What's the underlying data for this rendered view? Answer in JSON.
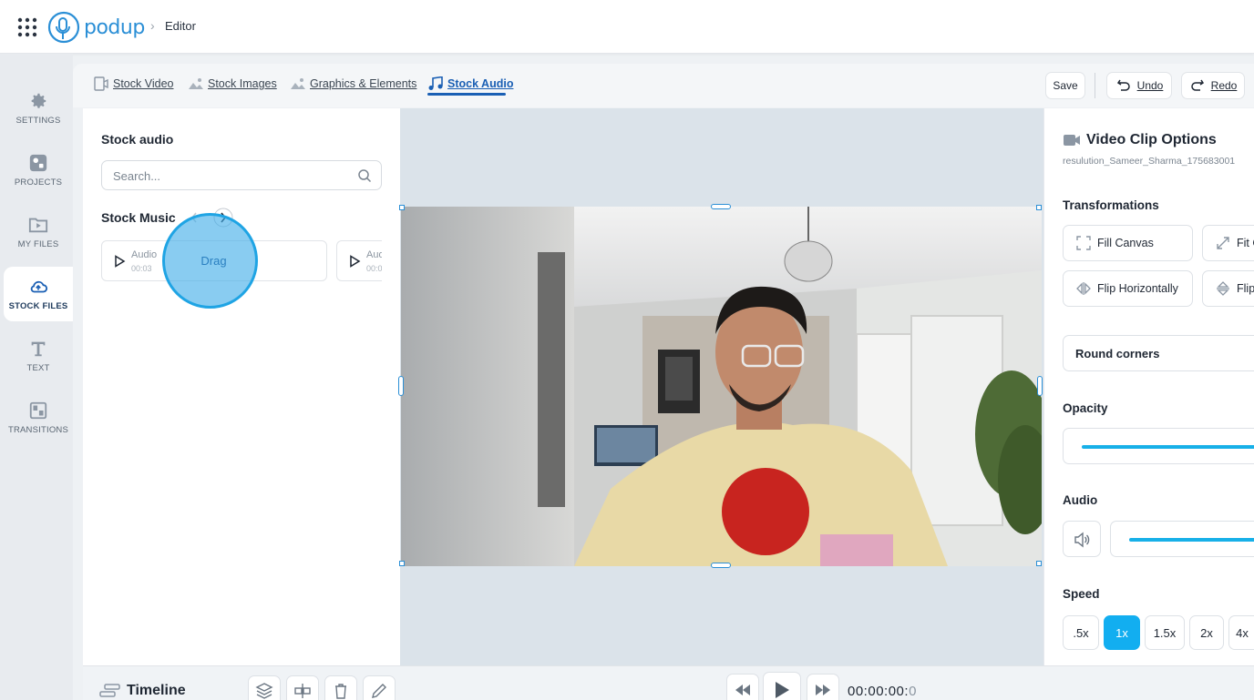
{
  "topbar": {
    "logo_text": "podup",
    "breadcrumb": "Editor"
  },
  "sidebar": {
    "items": [
      {
        "label": "SETTINGS",
        "icon": "gear-icon"
      },
      {
        "label": "PROJECTS",
        "icon": "projects-icon"
      },
      {
        "label": "MY FILES",
        "icon": "folder-play-icon"
      },
      {
        "label": "STOCK FILES",
        "icon": "cloud-icon",
        "active": true
      },
      {
        "label": "TEXT",
        "icon": "text-t-icon"
      },
      {
        "label": "TRANSITIONS",
        "icon": "transitions-icon"
      }
    ]
  },
  "tabs": {
    "items": [
      {
        "label": "Stock Video"
      },
      {
        "label": "Stock Images"
      },
      {
        "label": "Graphics & Elements"
      },
      {
        "label": "Stock Audio",
        "active": true
      }
    ],
    "save_label": "Save",
    "undo_label": "Undo",
    "redo_label": "Redo"
  },
  "left_panel": {
    "title": "Stock audio",
    "search_placeholder": "Search...",
    "music_title": "Stock Music",
    "cards": [
      {
        "name": "Audio",
        "duration": "00:03"
      },
      {
        "name": "Aud",
        "duration": "00:0"
      }
    ],
    "drag_label": "Drag"
  },
  "right_panel": {
    "title": "Video Clip Options",
    "filename": "resulution_Sameer_Sharma_175683001",
    "transformations_label": "Transformations",
    "fill_canvas": "Fill Canvas",
    "fit_canvas": "Fit C",
    "flip_h": "Flip Horizontally",
    "flip_v": "Flip",
    "round_corners": "Round corners",
    "opacity_label": "Opacity",
    "audio_label": "Audio",
    "speed_label": "Speed",
    "speeds": [
      ".5x",
      "1x",
      "1.5x",
      "2x",
      "4x"
    ],
    "active_speed": "1x"
  },
  "timeline": {
    "title": "Timeline",
    "timecode_main": "00:00:00:",
    "timecode_frame": "0"
  },
  "colors": {
    "accent": "#12aef0",
    "brand": "#2b8fd6",
    "active_tab": "#1a5fb4"
  }
}
